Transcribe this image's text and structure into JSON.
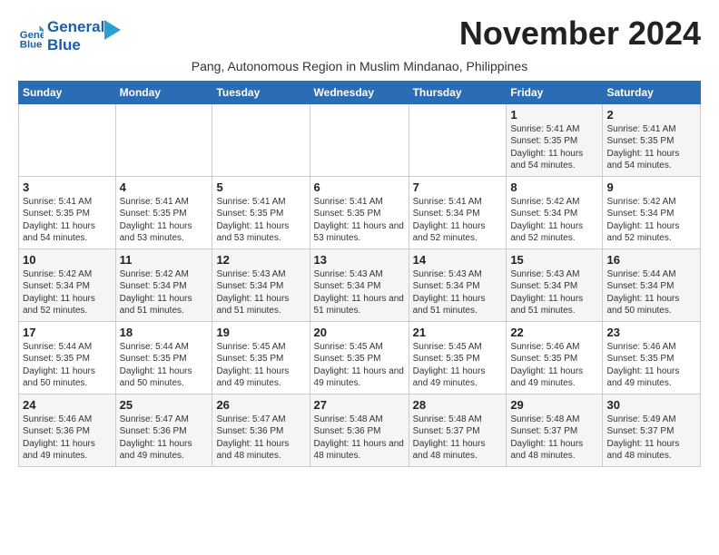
{
  "header": {
    "logo_line1": "General",
    "logo_line2": "Blue",
    "month_title": "November 2024",
    "subtitle": "Pang, Autonomous Region in Muslim Mindanao, Philippines"
  },
  "days_of_week": [
    "Sunday",
    "Monday",
    "Tuesday",
    "Wednesday",
    "Thursday",
    "Friday",
    "Saturday"
  ],
  "weeks": [
    [
      {
        "day": "",
        "info": ""
      },
      {
        "day": "",
        "info": ""
      },
      {
        "day": "",
        "info": ""
      },
      {
        "day": "",
        "info": ""
      },
      {
        "day": "",
        "info": ""
      },
      {
        "day": "1",
        "info": "Sunrise: 5:41 AM\nSunset: 5:35 PM\nDaylight: 11 hours and 54 minutes."
      },
      {
        "day": "2",
        "info": "Sunrise: 5:41 AM\nSunset: 5:35 PM\nDaylight: 11 hours and 54 minutes."
      }
    ],
    [
      {
        "day": "3",
        "info": "Sunrise: 5:41 AM\nSunset: 5:35 PM\nDaylight: 11 hours and 54 minutes."
      },
      {
        "day": "4",
        "info": "Sunrise: 5:41 AM\nSunset: 5:35 PM\nDaylight: 11 hours and 53 minutes."
      },
      {
        "day": "5",
        "info": "Sunrise: 5:41 AM\nSunset: 5:35 PM\nDaylight: 11 hours and 53 minutes."
      },
      {
        "day": "6",
        "info": "Sunrise: 5:41 AM\nSunset: 5:35 PM\nDaylight: 11 hours and 53 minutes."
      },
      {
        "day": "7",
        "info": "Sunrise: 5:41 AM\nSunset: 5:34 PM\nDaylight: 11 hours and 52 minutes."
      },
      {
        "day": "8",
        "info": "Sunrise: 5:42 AM\nSunset: 5:34 PM\nDaylight: 11 hours and 52 minutes."
      },
      {
        "day": "9",
        "info": "Sunrise: 5:42 AM\nSunset: 5:34 PM\nDaylight: 11 hours and 52 minutes."
      }
    ],
    [
      {
        "day": "10",
        "info": "Sunrise: 5:42 AM\nSunset: 5:34 PM\nDaylight: 11 hours and 52 minutes."
      },
      {
        "day": "11",
        "info": "Sunrise: 5:42 AM\nSunset: 5:34 PM\nDaylight: 11 hours and 51 minutes."
      },
      {
        "day": "12",
        "info": "Sunrise: 5:43 AM\nSunset: 5:34 PM\nDaylight: 11 hours and 51 minutes."
      },
      {
        "day": "13",
        "info": "Sunrise: 5:43 AM\nSunset: 5:34 PM\nDaylight: 11 hours and 51 minutes."
      },
      {
        "day": "14",
        "info": "Sunrise: 5:43 AM\nSunset: 5:34 PM\nDaylight: 11 hours and 51 minutes."
      },
      {
        "day": "15",
        "info": "Sunrise: 5:43 AM\nSunset: 5:34 PM\nDaylight: 11 hours and 51 minutes."
      },
      {
        "day": "16",
        "info": "Sunrise: 5:44 AM\nSunset: 5:34 PM\nDaylight: 11 hours and 50 minutes."
      }
    ],
    [
      {
        "day": "17",
        "info": "Sunrise: 5:44 AM\nSunset: 5:35 PM\nDaylight: 11 hours and 50 minutes."
      },
      {
        "day": "18",
        "info": "Sunrise: 5:44 AM\nSunset: 5:35 PM\nDaylight: 11 hours and 50 minutes."
      },
      {
        "day": "19",
        "info": "Sunrise: 5:45 AM\nSunset: 5:35 PM\nDaylight: 11 hours and 49 minutes."
      },
      {
        "day": "20",
        "info": "Sunrise: 5:45 AM\nSunset: 5:35 PM\nDaylight: 11 hours and 49 minutes."
      },
      {
        "day": "21",
        "info": "Sunrise: 5:45 AM\nSunset: 5:35 PM\nDaylight: 11 hours and 49 minutes."
      },
      {
        "day": "22",
        "info": "Sunrise: 5:46 AM\nSunset: 5:35 PM\nDaylight: 11 hours and 49 minutes."
      },
      {
        "day": "23",
        "info": "Sunrise: 5:46 AM\nSunset: 5:35 PM\nDaylight: 11 hours and 49 minutes."
      }
    ],
    [
      {
        "day": "24",
        "info": "Sunrise: 5:46 AM\nSunset: 5:36 PM\nDaylight: 11 hours and 49 minutes."
      },
      {
        "day": "25",
        "info": "Sunrise: 5:47 AM\nSunset: 5:36 PM\nDaylight: 11 hours and 49 minutes."
      },
      {
        "day": "26",
        "info": "Sunrise: 5:47 AM\nSunset: 5:36 PM\nDaylight: 11 hours and 48 minutes."
      },
      {
        "day": "27",
        "info": "Sunrise: 5:48 AM\nSunset: 5:36 PM\nDaylight: 11 hours and 48 minutes."
      },
      {
        "day": "28",
        "info": "Sunrise: 5:48 AM\nSunset: 5:37 PM\nDaylight: 11 hours and 48 minutes."
      },
      {
        "day": "29",
        "info": "Sunrise: 5:48 AM\nSunset: 5:37 PM\nDaylight: 11 hours and 48 minutes."
      },
      {
        "day": "30",
        "info": "Sunrise: 5:49 AM\nSunset: 5:37 PM\nDaylight: 11 hours and 48 minutes."
      }
    ]
  ]
}
